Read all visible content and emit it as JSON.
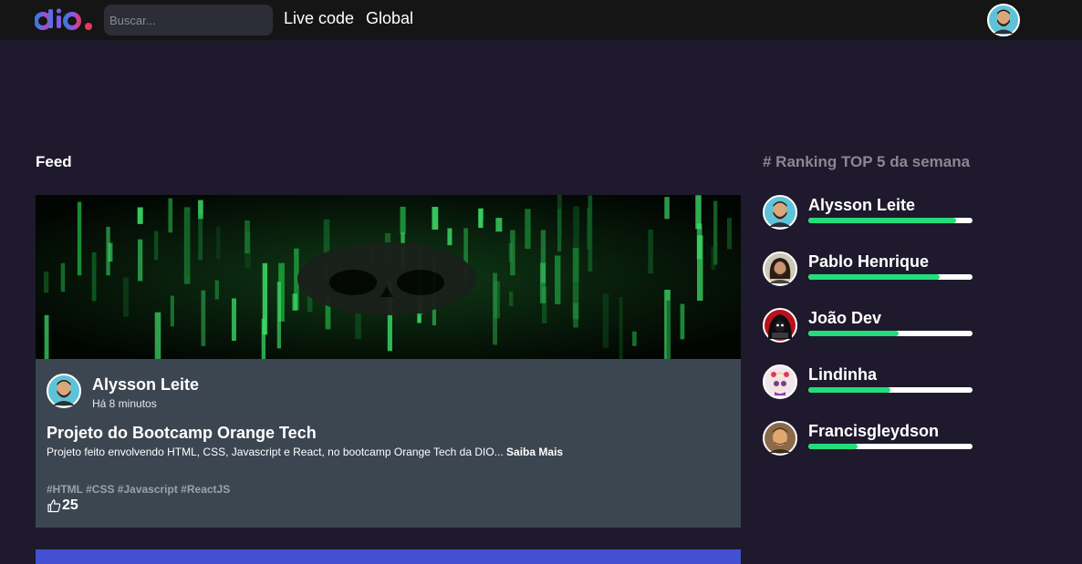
{
  "header": {
    "logo_text": "dio.",
    "search_placeholder": "Buscar...",
    "nav": [
      {
        "label": "Live code"
      },
      {
        "label": "Global"
      }
    ]
  },
  "feed": {
    "title": "Feed",
    "post": {
      "author": "Alysson Leite",
      "time": "Há 8 minutos",
      "title": "Projeto do Bootcamp Orange Tech",
      "description": "Projeto feito envolvendo HTML, CSS, Javascript e React, no bootcamp Orange Tech da DIO...",
      "read_more": "Saiba Mais",
      "tags": "#HTML #CSS #Javascript #ReactJS",
      "likes": "25"
    }
  },
  "ranking": {
    "title": "# Ranking TOP 5 da semana",
    "items": [
      {
        "name": "Alysson Leite",
        "progress": 0.9
      },
      {
        "name": "Pablo Henrique",
        "progress": 0.8
      },
      {
        "name": "João Dev",
        "progress": 0.55
      },
      {
        "name": "Lindinha",
        "progress": 0.5
      },
      {
        "name": "Francisgleydson",
        "progress": 0.3
      }
    ]
  },
  "colors": {
    "background": "#1e192c",
    "topbar": "#151515",
    "card": "#3b4651",
    "progress_fill": "#23dd7a",
    "progress_track": "#ffffff",
    "next_card": "#4350d2"
  }
}
